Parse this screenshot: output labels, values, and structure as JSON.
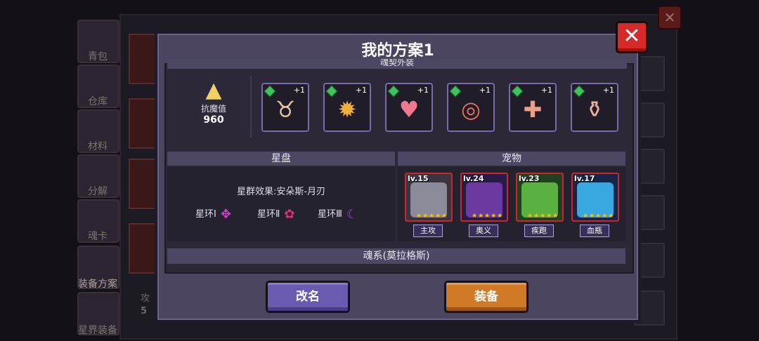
{
  "modal": {
    "title": "我的方案1",
    "close_symbol": "✕",
    "top_section_header": "魂契外装",
    "resistance": {
      "label": "抗魔值",
      "value": "960"
    },
    "equipment": [
      {
        "icon": "horns-icon",
        "glyph": "♉",
        "level": "+1",
        "color": "#e8c8a0"
      },
      {
        "icon": "gear-core-icon",
        "glyph": "✹",
        "level": "+1",
        "color": "#f0b040"
      },
      {
        "icon": "heart-crystal-icon",
        "glyph": "♥",
        "level": "+1",
        "color": "#f07890"
      },
      {
        "icon": "ring-necklace-icon",
        "glyph": "◎",
        "level": "+1",
        "color": "#e87060"
      },
      {
        "icon": "cross-charm-icon",
        "glyph": "✚",
        "level": "+1",
        "color": "#e8a088"
      },
      {
        "icon": "potion-bottle-icon",
        "glyph": "⚱",
        "level": "+1",
        "color": "#e8b0a0"
      }
    ],
    "star_section": {
      "header": "星盘",
      "constellation": "星群效果:安朵斯-月刃",
      "rings": [
        {
          "label": "星环Ⅰ",
          "icon": "bird-rune-icon",
          "glyph": "✥",
          "color": "#d040d0"
        },
        {
          "label": "星环Ⅱ",
          "icon": "flower-rune-icon",
          "glyph": "✿",
          "color": "#e03070"
        },
        {
          "label": "星环Ⅲ",
          "icon": "crescent-rune-icon",
          "glyph": "☾",
          "color": "#a040e0"
        }
      ]
    },
    "pet_section": {
      "header": "宠物",
      "pets": [
        {
          "level": "lv.15",
          "tag": "主攻",
          "bg": "#3a3440",
          "face": "#8a8a98",
          "stars": "★★★★★"
        },
        {
          "level": "lv.24",
          "tag": "奥义",
          "bg": "#2a1a48",
          "face": "#6a3aa0",
          "stars": "★★★★★"
        },
        {
          "level": "lv.23",
          "tag": "疾跑",
          "bg": "#204020",
          "face": "#5ab040",
          "stars": "★★★★★"
        },
        {
          "level": "lv.17",
          "tag": "血瓶",
          "bg": "#182448",
          "face": "#3aa8e0",
          "stars": "★★★★★"
        }
      ]
    },
    "bottom_section_header": "魂系(莫拉格斯)",
    "rename_button": "改名",
    "equip_button": "装备"
  },
  "background": {
    "side_menu": [
      "青包",
      "仓库",
      "材料",
      "分解",
      "魂卡",
      "装备方案",
      "星界装备"
    ],
    "partial_text": [
      "攻",
      "5"
    ],
    "close_symbol": "✕"
  }
}
